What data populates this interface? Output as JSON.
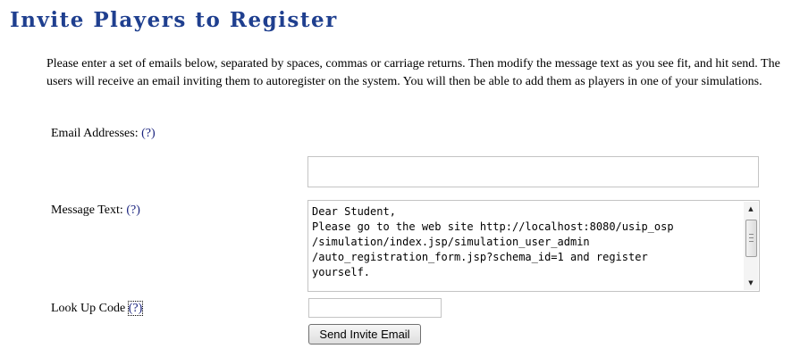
{
  "page": {
    "title": "Invite Players to Register",
    "intro": "Please enter a set of emails below, separated by spaces, commas or carriage returns. Then modify the message text as you see fit, and hit send. The users will receive an email inviting them to autoregister on the system. You will then be able to add them as players in one of your simulations."
  },
  "form": {
    "email": {
      "label": "Email Addresses:",
      "help": "(?)",
      "value": ""
    },
    "message": {
      "label": "Message Text:",
      "help": "(?)",
      "value": "Dear Student,\nPlease go to the web site http://localhost:8080/usip_osp\n/simulation/index.jsp/simulation_user_admin\n/auto_registration_form.jsp?schema_id=1 and register\nyourself."
    },
    "lookup_code": {
      "label": "Look Up Code",
      "help": "(?)",
      "value": ""
    },
    "send_button": "Send Invite Email"
  },
  "scrollbar": {
    "up_glyph": "▲",
    "down_glyph": "▼"
  },
  "colors": {
    "title": "#1f3f8f",
    "help_link": "#1a237e"
  }
}
